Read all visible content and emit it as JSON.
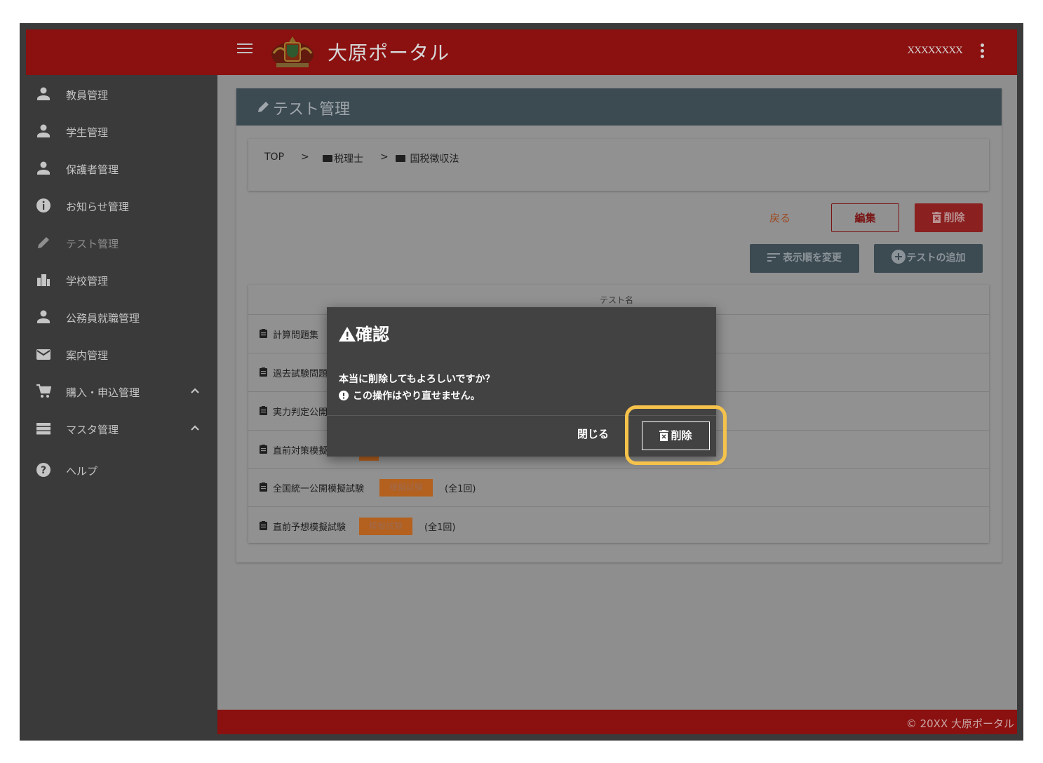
{
  "app": {
    "title": "大原ポータル",
    "user_name": "XXXXXXXX"
  },
  "sidebar": {
    "items": [
      {
        "label": "教員管理",
        "icon": "person-icon"
      },
      {
        "label": "学生管理",
        "icon": "person-icon"
      },
      {
        "label": "保護者管理",
        "icon": "person-icon"
      },
      {
        "label": "お知らせ管理",
        "icon": "info-icon"
      },
      {
        "label": "テスト管理",
        "icon": "pencil-icon"
      },
      {
        "label": "学校管理",
        "icon": "building-icon"
      },
      {
        "label": "公務員就職管理",
        "icon": "person-icon"
      },
      {
        "label": "案内管理",
        "icon": "mail-icon"
      },
      {
        "label": "購入・申込管理",
        "icon": "cart-icon"
      },
      {
        "label": "マスタ管理",
        "icon": "storage-icon"
      },
      {
        "label": "ヘルプ",
        "icon": "help-icon"
      }
    ]
  },
  "page": {
    "title": "テスト管理",
    "breadcrumb": {
      "root": "TOP",
      "sep": ">",
      "level1": "税理士",
      "level2": "国税徴収法"
    },
    "buttons": {
      "back": "戻る",
      "edit": "編集",
      "delete": "削除",
      "reorder": "表示順を変更",
      "add_test": "テストの追加"
    },
    "table": {
      "column": "テスト名",
      "rows": [
        {
          "name": "計算問題集",
          "badge": "",
          "count": ""
        },
        {
          "name": "過去試験問題",
          "badge": "",
          "count": ""
        },
        {
          "name": "実力判定公開",
          "badge": "",
          "count": ""
        },
        {
          "name": "直前対策模擬",
          "badge": "",
          "count": ""
        },
        {
          "name": "全国統一公開模擬試験",
          "badge": "模擬試験",
          "count": "(全1回)"
        },
        {
          "name": "直前予想模擬試験",
          "badge": "模擬試験",
          "count": "(全1回)"
        }
      ]
    }
  },
  "modal": {
    "title": "確認",
    "message": "本当に削除してもよろしいですか？",
    "note": "この操作はやり直せません。",
    "close": "閉じる",
    "confirm": "削除"
  },
  "footer": {
    "text": "© 20XX 大原ポータル"
  },
  "colors": {
    "brand": "#8b1010",
    "header": "#3c4a52",
    "badge": "#b4601e",
    "highlight": "#f5c24b"
  }
}
